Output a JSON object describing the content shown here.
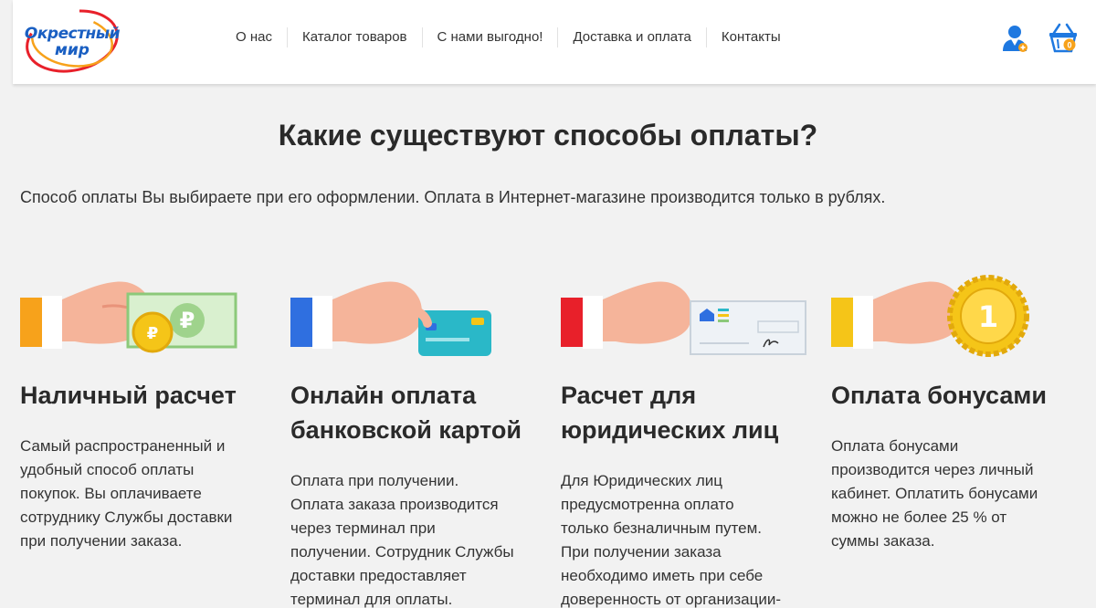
{
  "header": {
    "logo_line1": "Окрестный",
    "logo_line2": "мир",
    "nav": [
      "О нас",
      "Каталог товаров",
      "С нами выгодно!",
      "Доставка и оплата",
      "Контакты"
    ],
    "cart_count": "0"
  },
  "page": {
    "title": "Какие существуют способы оплаты?",
    "intro": "Способ оплаты Вы выбираете при его оформлении. Оплата в Интернет-магазине производится только в рублях."
  },
  "methods": [
    {
      "title_lines": [
        "Наличный расчет"
      ],
      "text_lines": [
        "Самый распространенный и",
        "удобный способ оплаты",
        "покупок. Вы оплачиваете",
        "сотруднику Службы доставки",
        "при получении заказа."
      ],
      "cuff_color": "#f7a21b"
    },
    {
      "title_lines": [
        "Онлайн оплата",
        "банковской картой"
      ],
      "text_lines": [
        "Оплата при получении.",
        "Оплата заказа производится",
        "через терминал при",
        "получении. Сотрудник Службы",
        "доставки предоставляет",
        "терминал для оплаты."
      ],
      "cuff_color": "#2f6fe0"
    },
    {
      "title_lines": [
        "Расчет для",
        "юридических лиц"
      ],
      "text_lines": [
        "Для Юридических лиц",
        "предусмотренна оплато",
        "только безналичным путем.",
        "При получении заказа",
        "необходимо иметь при себе",
        "доверенность от организации-"
      ],
      "cuff_color": "#e8202a"
    },
    {
      "title_lines": [
        "Оплата бонусами"
      ],
      "text_lines": [
        "Оплата бонусами",
        "производится через личный",
        "кабинет. Оплатить бонусами",
        "можно не более 25 % от",
        "суммы заказа."
      ],
      "cuff_color": "#f5c518"
    }
  ],
  "coin_label": "1"
}
